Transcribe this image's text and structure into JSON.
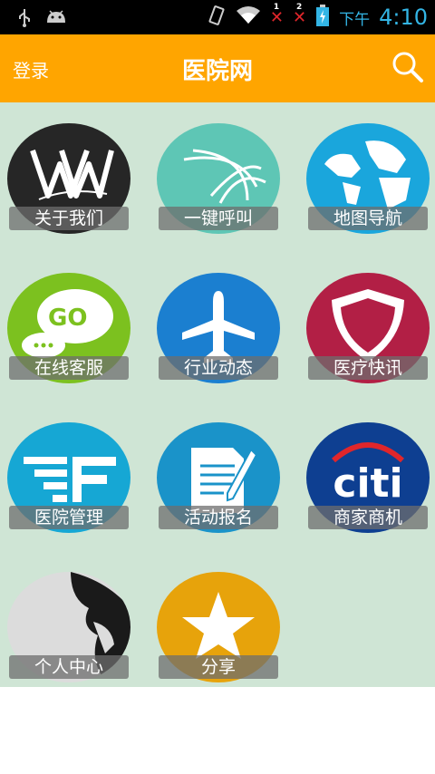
{
  "status": {
    "time_prefix": "下午",
    "time": "4:10",
    "sim1": "1",
    "sim2": "2"
  },
  "appbar": {
    "login": "登录",
    "title": "医院网"
  },
  "tiles": [
    {
      "label": "关于我们",
      "color": "#2a2a2a"
    },
    {
      "label": "一键呼叫",
      "color": "#5ec6b5"
    },
    {
      "label": "地图导航",
      "color": "#1aa6dc"
    },
    {
      "label": "在线客服",
      "color": "#7cc11f"
    },
    {
      "label": "行业动态",
      "color": "#1b7fd0"
    },
    {
      "label": "医疗快讯",
      "color": "#b21f45"
    },
    {
      "label": "医院管理",
      "color": "#16a7d4"
    },
    {
      "label": "活动报名",
      "color": "#1a93c9"
    },
    {
      "label": "商家商机",
      "color": "#0e3f91"
    },
    {
      "label": "个人中心",
      "color": "#dcdcdc"
    },
    {
      "label": "分享",
      "color": "#e7a30b"
    }
  ],
  "icons": {
    "t1": "wwe-logo-icon",
    "t2": "swipe-arcs-icon",
    "t3": "globe-icon",
    "t4": "go-chat-bubble-icon",
    "t5": "airplane-icon",
    "t6": "shield-icon",
    "t7": "ef-logo-icon",
    "t8": "document-pen-icon",
    "t9": "citi-logo-icon",
    "t10": "world-map-icon",
    "t11": "star-icon"
  },
  "logos": {
    "go": "GO",
    "citi": "citi"
  }
}
